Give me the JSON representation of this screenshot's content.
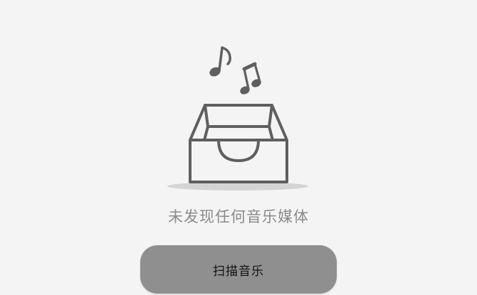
{
  "empty_state": {
    "icon": "empty-music-tray-icon",
    "message": "未发现任何音乐媒体"
  },
  "actions": {
    "scan_label": "扫描音乐"
  },
  "colors": {
    "background": "#f4f4f4",
    "icon_stroke": "#5f5f5f",
    "message_text": "#8a8a8a",
    "button_fill": "#8f8f8f",
    "button_text": "#111111"
  }
}
